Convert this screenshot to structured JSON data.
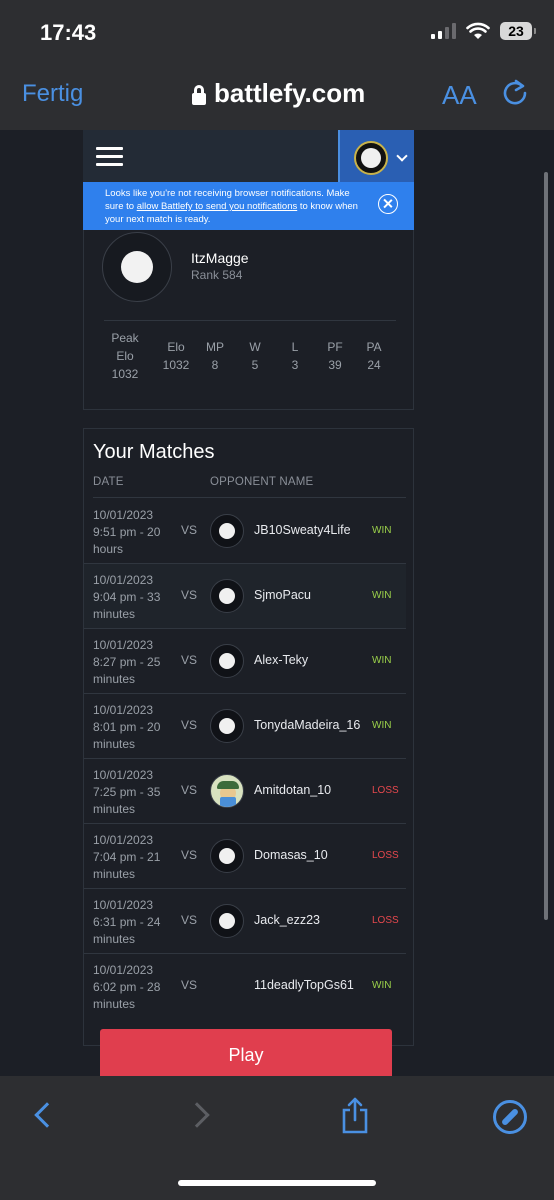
{
  "status_bar": {
    "time": "17:43",
    "battery": "23"
  },
  "browser": {
    "done_label": "Fertig",
    "url": "battlefy.com",
    "aa_label": "AA"
  },
  "notification": {
    "text_before": "Looks like you're not receiving browser notifications. Make sure to ",
    "link": "allow Battlefy to send you notifications",
    "text_after": " to know when your next match is ready."
  },
  "profile": {
    "name": "ItzMagge",
    "rank": "Rank 584",
    "stats": [
      {
        "label": "Peak Elo",
        "value": "1032"
      },
      {
        "label": "Elo",
        "value": "1032"
      },
      {
        "label": "MP",
        "value": "8"
      },
      {
        "label": "W",
        "value": "5"
      },
      {
        "label": "L",
        "value": "3"
      },
      {
        "label": "PF",
        "value": "39"
      },
      {
        "label": "PA",
        "value": "24"
      }
    ]
  },
  "matches": {
    "title": "Your Matches",
    "col_date": "DATE",
    "col_opponent": "OPPONENT NAME",
    "vs": "VS",
    "rows": [
      {
        "date": "10/01/2023",
        "time": "9:51 pm - 20 hours",
        "opponent": "JB10Sweaty4Life",
        "result": "WIN"
      },
      {
        "date": "10/01/2023",
        "time": "9:04 pm - 33 minutes",
        "opponent": "SjmoPacu",
        "result": "WIN"
      },
      {
        "date": "10/01/2023",
        "time": "8:27 pm - 25 minutes",
        "opponent": "Alex-Teky",
        "result": "WIN"
      },
      {
        "date": "10/01/2023",
        "time": "8:01 pm - 20 minutes",
        "opponent": "TonydaMadeira_16",
        "result": "WIN"
      },
      {
        "date": "10/01/2023",
        "time": "7:25 pm - 35 minutes",
        "opponent": "Amitdotan_10",
        "result": "LOSS"
      },
      {
        "date": "10/01/2023",
        "time": "7:04 pm - 21 minutes",
        "opponent": "Domasas_10",
        "result": "LOSS"
      },
      {
        "date": "10/01/2023",
        "time": "6:31 pm - 24 minutes",
        "opponent": "Jack_ezz23",
        "result": "LOSS"
      },
      {
        "date": "10/01/2023",
        "time": "6:02 pm - 28 minutes",
        "opponent": "11deadlyTopGs61",
        "result": "WIN"
      }
    ]
  },
  "play_label": "Play",
  "colors": {
    "accent": "#4a90e2",
    "win": "#9bd14a",
    "loss": "#e5484d",
    "play": "#e03e4e",
    "banner": "#2f80ed"
  }
}
